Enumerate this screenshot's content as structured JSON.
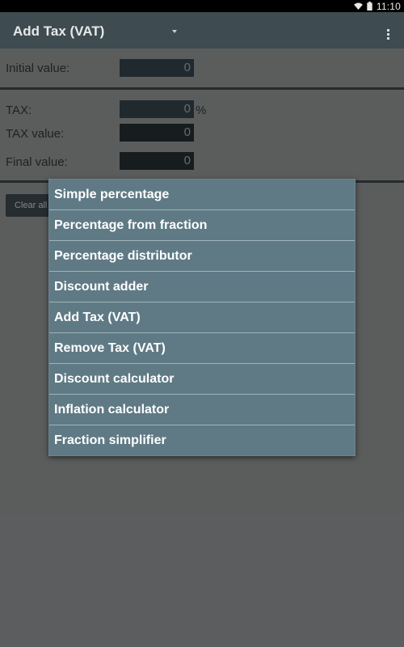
{
  "status_bar": {
    "time": "11:10",
    "icons": [
      "wifi-icon",
      "battery-icon"
    ]
  },
  "action_bar": {
    "title": "Add Tax (VAT)",
    "spinner_icon": "chevron-down-icon",
    "overflow_icon": "more-vertical-icon"
  },
  "form": {
    "initial_value": {
      "label": "Initial value:",
      "value": "0"
    },
    "tax": {
      "label": "TAX:",
      "value": "0",
      "unit": "%"
    },
    "tax_value": {
      "label": "TAX value:",
      "value": "0"
    },
    "final_value": {
      "label": "Final value:",
      "value": "0"
    },
    "clear_button": "Clear all"
  },
  "menu": {
    "items": [
      "Simple percentage",
      "Percentage from fraction",
      "Percentage distributor",
      "Discount adder",
      "Add Tax (VAT)",
      "Remove Tax (VAT)",
      "Discount calculator",
      "Inflation calculator",
      "Fraction simplifier"
    ]
  },
  "colors": {
    "action_bar": "#3e4b51",
    "menu_background": "#5f7a85",
    "menu_text": "#ffffff"
  }
}
